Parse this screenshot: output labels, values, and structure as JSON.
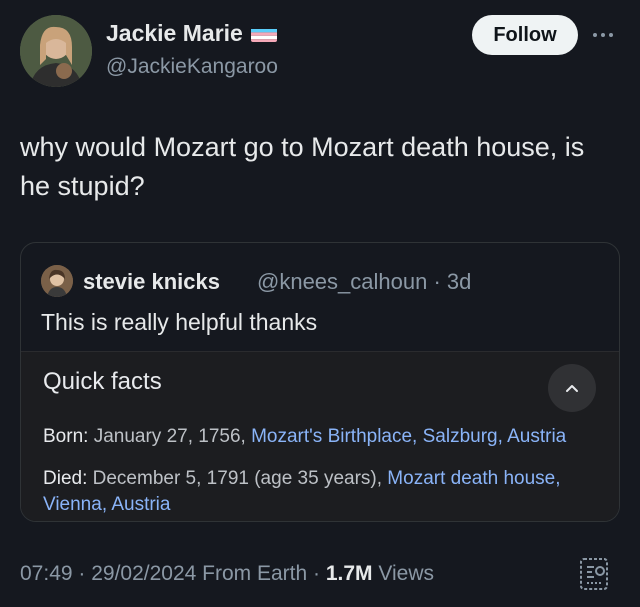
{
  "author": {
    "display_name": "Jackie Marie",
    "handle": "@JackieKangaroo",
    "flag_icon": "transgender-flag-icon"
  },
  "follow_label": "Follow",
  "tweet_text": "why would Mozart go to Mozart death house, is he stupid?",
  "quoted": {
    "display_name": "stevie knicks",
    "handle_time": "@knees_calhoun · 3d",
    "text": "This is really helpful thanks",
    "quick_facts": {
      "title": "Quick facts",
      "born_label": "Born:",
      "born_date": " January 27, 1756, ",
      "born_place": "Mozart's Birthplace, Salzburg, Austria",
      "died_label": "Died:",
      "died_date": " December 5, 1791 (age 35 years), ",
      "died_place": "Mozart death house, Vienna, Austria"
    }
  },
  "meta": {
    "time_date": "07:49 · 29/02/2024 From Earth · ",
    "views_count": "1.7M",
    "views_label": " Views"
  },
  "colors": {
    "background": "#15181f",
    "link": "#8ab4f8",
    "muted": "#8b98a5"
  }
}
